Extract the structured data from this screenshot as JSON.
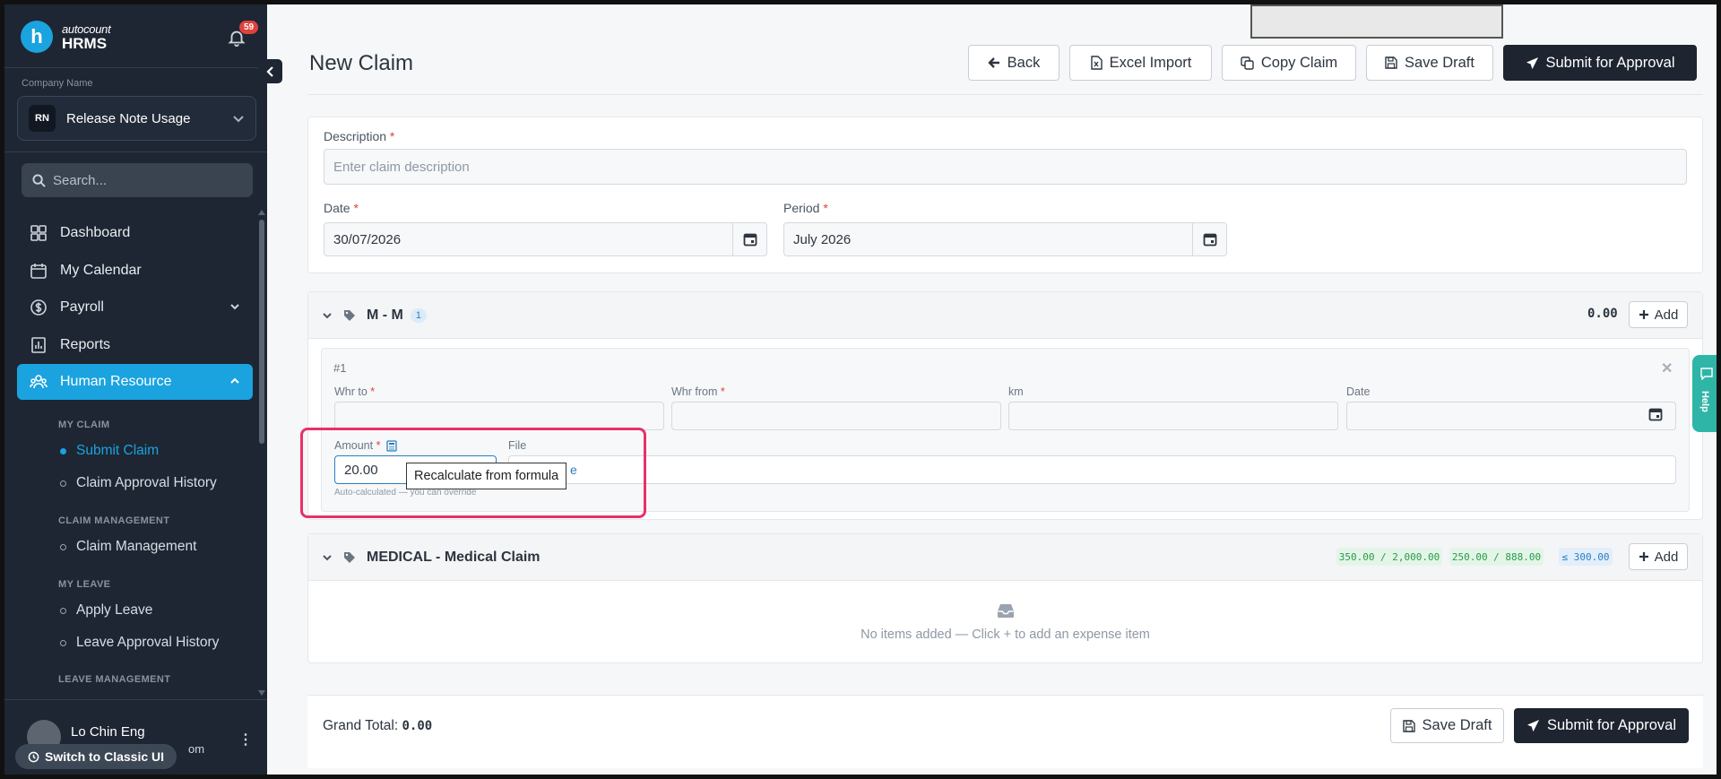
{
  "sidebar": {
    "logo_top": "autocount",
    "logo_bottom": "HRMS",
    "logo_mark": "h",
    "notifications": "59",
    "company_label": "Company Name",
    "company_initials": "RN",
    "company_name": "Release Note Usage",
    "search_placeholder": "Search...",
    "nav": {
      "dashboard": "Dashboard",
      "calendar": "My Calendar",
      "payroll": "Payroll",
      "reports": "Reports",
      "human_resource": "Human Resource"
    },
    "sections": {
      "my_claim": "MY CLAIM",
      "claim_management": "CLAIM MANAGEMENT",
      "my_leave": "MY LEAVE",
      "leave_management": "LEAVE MANAGEMENT"
    },
    "sub": {
      "submit_claim": "Submit Claim",
      "claim_approval_history": "Claim Approval History",
      "claim_management": "Claim Management",
      "apply_leave": "Apply Leave",
      "leave_approval_history": "Leave Approval History"
    },
    "user_name": "Lo Chin Eng",
    "user_email_fragment": "om",
    "switch_label": "Switch to Classic UI"
  },
  "header": {
    "title": "New Claim",
    "back": "Back",
    "excel_import": "Excel Import",
    "copy_claim": "Copy Claim",
    "save_draft": "Save Draft",
    "submit": "Submit for Approval"
  },
  "form": {
    "description_label": "Description",
    "description_placeholder": "Enter claim description",
    "date_label": "Date",
    "date_value": "30/07/2026",
    "period_label": "Period",
    "period_value": "July 2026",
    "required_mark": "*"
  },
  "group_mm": {
    "title": "M - M",
    "count": "1",
    "total": "0.00",
    "add": "Add",
    "item_number": "#1",
    "whr_to": "Whr to",
    "whr_from": "Whr from",
    "km": "km",
    "date": "Date",
    "amount_label": "Amount",
    "amount_value": "20.00",
    "file_label": "File",
    "file_link": "e",
    "hint": "Auto-calculated — you can override",
    "tooltip": "Recalculate from formula"
  },
  "group_medical": {
    "title": "MEDICAL - Medical Claim",
    "limit1": "350.00 / 2,000.00",
    "limit2": "250.00 / 888.00",
    "limit3": "≤ 300.00",
    "add": "Add",
    "empty": "No items added — Click + to add an expense item"
  },
  "footer": {
    "grand_total_label": "Grand Total:",
    "grand_total_value": "0.00",
    "save_draft": "Save Draft",
    "submit": "Submit for Approval"
  },
  "help_label": "Help",
  "colors": {
    "accent": "#1aa3df",
    "sidebar_bg": "#1e2633",
    "dark_button": "#1e2430",
    "highlight": "#e8316a",
    "badge": "#e0413c",
    "help": "#2fb5a7"
  }
}
